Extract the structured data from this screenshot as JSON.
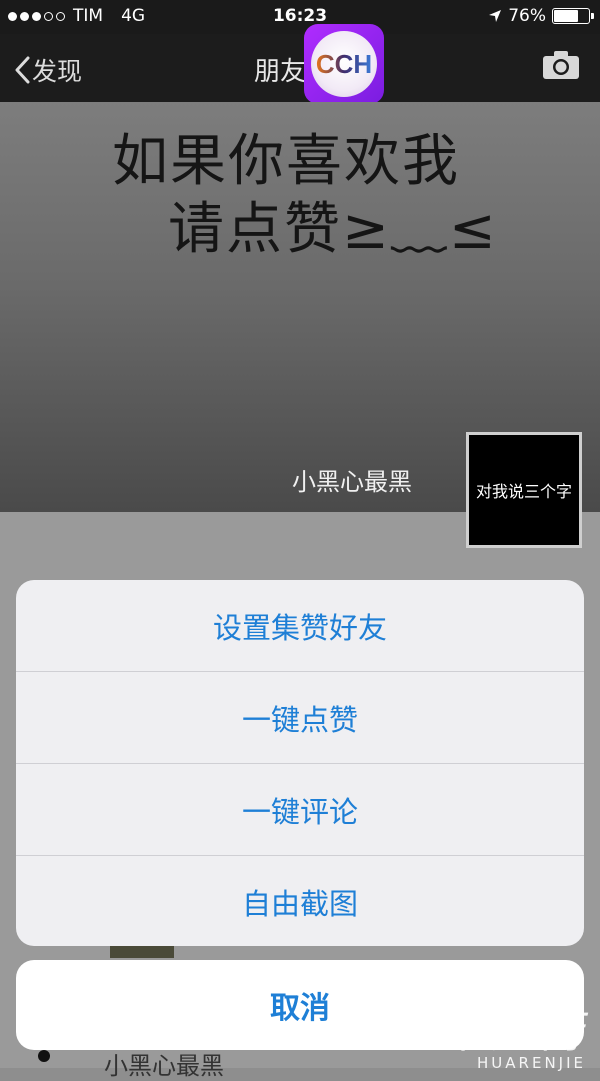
{
  "status_bar": {
    "carrier": "TIM",
    "network": "4G",
    "time": "16:23",
    "battery_percent": "76%",
    "battery_level": 0.76,
    "signal_dots_filled": 3,
    "signal_dots_total": 5
  },
  "nav": {
    "back_label": "发现",
    "title": "朋友"
  },
  "badge": {
    "text": "CCH"
  },
  "cover": {
    "line1": "如果你喜欢我",
    "line2": "请点赞≥﹏≤"
  },
  "profile": {
    "name": "小黑心最黑",
    "avatar_text": "对我说三个字"
  },
  "action_sheet": {
    "items": [
      "设置集赞好友",
      "一键点赞",
      "一键评论",
      "自由截图"
    ],
    "cancel": "取消"
  },
  "feed": {
    "bottom_name": "小黑心最黑"
  },
  "watermark": {
    "logo": "華人街",
    "sub": "HUARENJIE"
  },
  "colors": {
    "accent": "#1e7fd6",
    "navbar": "#1c1c1c",
    "badge": "#9b27f0"
  }
}
